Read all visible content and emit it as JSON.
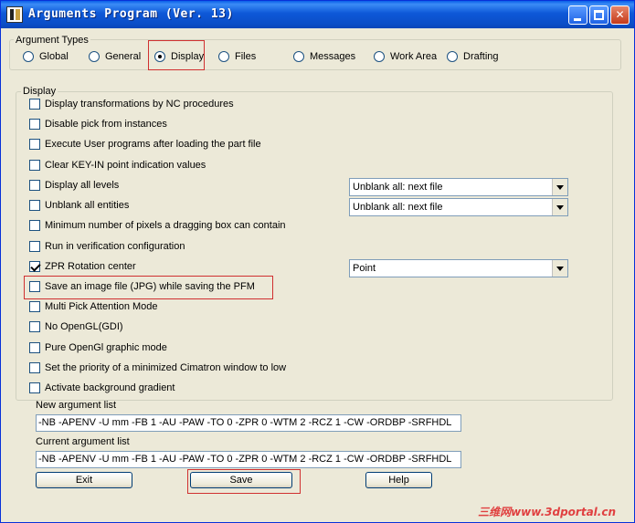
{
  "window": {
    "title": "Arguments Program (Ver. 13)"
  },
  "argument_types": {
    "legend": "Argument Types",
    "options": [
      "Global",
      "General",
      "Display",
      "Files",
      "Messages",
      "Work Area",
      "Drafting"
    ],
    "selected": "Display"
  },
  "display_group": {
    "legend": "Display",
    "items": [
      {
        "label": "Display transformations by NC procedures",
        "checked": false
      },
      {
        "label": "Disable pick from instances",
        "checked": false
      },
      {
        "label": "Execute User programs after loading the part file",
        "checked": false
      },
      {
        "label": "Clear KEY-IN point indication values",
        "checked": false
      },
      {
        "label": "Display all levels",
        "checked": false
      },
      {
        "label": "Unblank all entities",
        "checked": false
      },
      {
        "label": "Minimum number of pixels a dragging box can contain",
        "checked": false
      },
      {
        "label": "Run in verification configuration",
        "checked": false
      },
      {
        "label": "ZPR Rotation center",
        "checked": true
      },
      {
        "label": "Save an image file (JPG) while saving the PFM",
        "checked": false
      },
      {
        "label": "Multi Pick Attention Mode",
        "checked": false
      },
      {
        "label": "No OpenGL(GDI)",
        "checked": false
      },
      {
        "label": "Pure OpenGl graphic mode",
        "checked": false
      },
      {
        "label": "Set the priority of a minimized Cimatron window to low",
        "checked": false
      },
      {
        "label": "Activate background gradient",
        "checked": false
      }
    ],
    "combos": {
      "display_levels": "Unblank all: next file",
      "unblank_entities": "Unblank all: next file",
      "zpr_rotation": "Point"
    }
  },
  "new_argument_list": {
    "label": "New argument list",
    "value": "-NB -APENV -U mm -FB 1 -AU -PAW -TO 0 -ZPR 0 -WTM 2 -RCZ 1 -CW -ORDBP -SRFHDL"
  },
  "current_argument_list": {
    "label": "Current argument list",
    "value": "-NB -APENV -U mm -FB 1 -AU -PAW -TO 0 -ZPR 0 -WTM 2 -RCZ 1 -CW -ORDBP -SRFHDL"
  },
  "buttons": {
    "exit": "Exit",
    "save": "Save",
    "help": "Help"
  },
  "watermark": "三维网www.3dportal.cn"
}
